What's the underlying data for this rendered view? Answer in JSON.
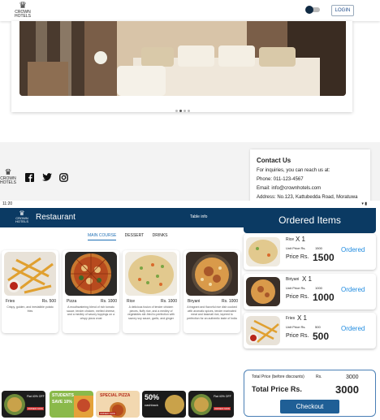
{
  "website": {
    "logo": {
      "top": "CROWN",
      "bottom": "HOTELS"
    },
    "login_label": "LOGIN",
    "footer_logo": {
      "top": "CROWN",
      "bottom": "HOTELS"
    },
    "contact": {
      "title": "Contact Us",
      "line1": "For inquiries, you can reach us at:",
      "phone": "Phone: 011-123-4567",
      "email": "Email: info@crownhotels.com",
      "address": "Address: No.123, Kattubedda Road, Moratuwa"
    }
  },
  "app": {
    "status_time": "11:20",
    "logo": {
      "top": "CROWN",
      "bottom": "HOTELS"
    },
    "title": "Restaurant",
    "table_info": "Table info",
    "tabs": [
      "MAIN COURSE",
      "DESSERT",
      "DRINKS"
    ],
    "menu": [
      {
        "name": "Fries",
        "price": "Rs. 500",
        "desc": "Crispy, golden, and irresistible potato fries"
      },
      {
        "name": "Pizza",
        "price": "Rs. 1000",
        "desc": "A mouthwatering blend of rich tomato sauce, tender chicken, melted cheese, and a medley of savory toppings on a crispy pizza crust"
      },
      {
        "name": "Rice",
        "price": "Rs. 1000",
        "desc": "A delicious fusion of tender chicken pieces, fluffy rice, and a medley of vegetables stir-fried to perfection with savory soy sauce, garlic, and ginger"
      },
      {
        "name": "Biryani",
        "price": "Rs. 1000",
        "desc": "A fragrant and flavorful rice dish cooked with aromatic spices, tender marinated meat and basmati rice, layered to perfection for an authentic taste of India"
      }
    ],
    "ordered": {
      "title": "Ordered Items",
      "items": [
        {
          "name": "Rice",
          "qty": "X 1",
          "unit_label": "Unit Price Rs.",
          "unit_price": "1500",
          "price_label": "Price  Rs.",
          "price": "1500",
          "status": "Ordered"
        },
        {
          "name": "Biriyani",
          "qty": "X 1",
          "unit_label": "Unit Price Rs.",
          "unit_price": "1000",
          "price_label": "Price  Rs.",
          "price": "1000",
          "status": "Ordered"
        },
        {
          "name": "Fries",
          "qty": "X 1",
          "unit_label": "Unit Price Rs.",
          "unit_price": "500",
          "price_label": "Price  Rs.",
          "price": "500",
          "status": "Ordered"
        }
      ]
    },
    "totals": {
      "before_label": "Total Price (before discounts)",
      "before_rs": "Rs.",
      "before_value": "3000",
      "total_label": "Total Price Rs.",
      "total_value": "3000",
      "checkout_label": "Checkout"
    },
    "promos": [
      {
        "line1": "Flat 40% OFF",
        "line2": "ORDER NOW"
      },
      {
        "line1": "STUDENTS",
        "line2": "SAVE 10%"
      },
      {
        "line1": "SPECIAL PIZZA",
        "line2": "ORDER NOW"
      },
      {
        "line1": "50%",
        "line2": "cashback"
      },
      {
        "line1": "Flat 40% OFF",
        "line2": "ORDER NOW"
      }
    ]
  }
}
